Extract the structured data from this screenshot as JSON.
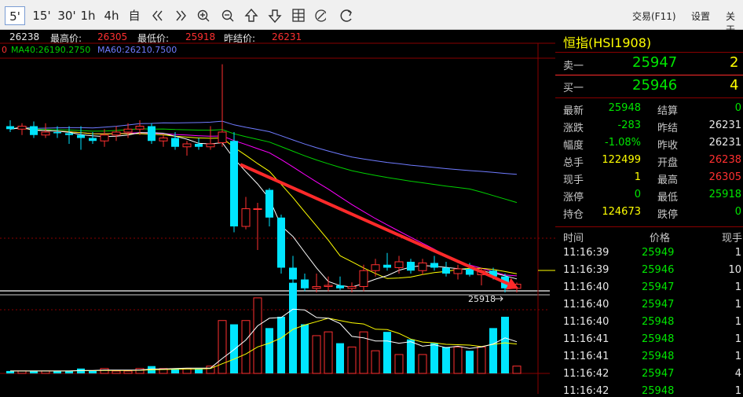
{
  "toolbar": {
    "periods": [
      "5'",
      "15'",
      "30'",
      "1h",
      "4h",
      "自"
    ],
    "right_items": [
      "交易(F11)",
      "设置",
      "关于"
    ],
    "icons": [
      "double-left-icon",
      "double-right-icon",
      "zoom-in-icon",
      "zoom-out-icon",
      "up-arrow-icon",
      "down-arrow-icon",
      "layout-icon",
      "draw-icon",
      "refresh-icon"
    ]
  },
  "chart_header": {
    "open_value": "26238",
    "high_label": "最高价:",
    "high_value": "26305",
    "low_label": "最低价:",
    "low_value": "25918",
    "prev_label": "昨结价:",
    "prev_value": "26231"
  },
  "ma_line": {
    "prefix": "0",
    "ma40": "MA40:26190.2750",
    "ma60": "MA60:26210.7500"
  },
  "low_marker": "25918",
  "colors": {
    "up": "#ff3030",
    "down": "#00e5ff",
    "arrow": "#ff2a2a",
    "ma5": "#ffffff",
    "ma10": "#ffff00",
    "ma20": "#ff00ff",
    "ma40": "#00d000",
    "ma60": "#6f7bff",
    "divider": "#8a0000"
  },
  "chart_data": {
    "type": "candlestick",
    "title": "",
    "candles": [
      {
        "o": 26200,
        "h": 26210,
        "l": 26190,
        "c": 26195,
        "v": 1
      },
      {
        "o": 26195,
        "h": 26205,
        "l": 26185,
        "c": 26200,
        "v": 1
      },
      {
        "o": 26200,
        "h": 26208,
        "l": 26180,
        "c": 26185,
        "v": 1
      },
      {
        "o": 26185,
        "h": 26205,
        "l": 26180,
        "c": 26190,
        "v": 1
      },
      {
        "o": 26190,
        "h": 26200,
        "l": 26180,
        "c": 26188,
        "v": 1
      },
      {
        "o": 26188,
        "h": 26200,
        "l": 26170,
        "c": 26185,
        "v": 1
      },
      {
        "o": 26185,
        "h": 26200,
        "l": 26160,
        "c": 26180,
        "v": 2
      },
      {
        "o": 26180,
        "h": 26190,
        "l": 26170,
        "c": 26175,
        "v": 1
      },
      {
        "o": 26175,
        "h": 26195,
        "l": 26165,
        "c": 26185,
        "v": 2
      },
      {
        "o": 26185,
        "h": 26200,
        "l": 26175,
        "c": 26190,
        "v": 1
      },
      {
        "o": 26190,
        "h": 26205,
        "l": 26180,
        "c": 26195,
        "v": 1
      },
      {
        "o": 26195,
        "h": 26210,
        "l": 26185,
        "c": 26200,
        "v": 2
      },
      {
        "o": 26200,
        "h": 26205,
        "l": 26170,
        "c": 26175,
        "v": 3
      },
      {
        "o": 26175,
        "h": 26185,
        "l": 26165,
        "c": 26180,
        "v": 2
      },
      {
        "o": 26180,
        "h": 26190,
        "l": 26160,
        "c": 26165,
        "v": 2
      },
      {
        "o": 26165,
        "h": 26175,
        "l": 26150,
        "c": 26170,
        "v": 2
      },
      {
        "o": 26170,
        "h": 26180,
        "l": 26160,
        "c": 26165,
        "v": 2
      },
      {
        "o": 26165,
        "h": 26200,
        "l": 26160,
        "c": 26170,
        "v": 3
      },
      {
        "o": 26172,
        "h": 26305,
        "l": 26165,
        "c": 26190,
        "v": 14
      },
      {
        "o": 26175,
        "h": 26190,
        "l": 26020,
        "c": 26030,
        "v": 13
      },
      {
        "o": 26030,
        "h": 26080,
        "l": 26025,
        "c": 26060,
        "v": 14
      },
      {
        "o": 26060,
        "h": 26070,
        "l": 25990,
        "c": 26060,
        "v": 20
      },
      {
        "o": 26092,
        "h": 26095,
        "l": 26030,
        "c": 26045,
        "v": 12
      },
      {
        "o": 26045,
        "h": 26050,
        "l": 25950,
        "c": 25960,
        "v": 15
      },
      {
        "o": 25960,
        "h": 25980,
        "l": 25930,
        "c": 25940,
        "v": 24
      },
      {
        "o": 25940,
        "h": 25950,
        "l": 25920,
        "c": 25925,
        "v": 13
      },
      {
        "o": 25925,
        "h": 25950,
        "l": 25918,
        "c": 25928,
        "v": 10
      },
      {
        "o": 25928,
        "h": 25945,
        "l": 25920,
        "c": 25930,
        "v": 11
      },
      {
        "o": 25930,
        "h": 25945,
        "l": 25922,
        "c": 25925,
        "v": 8
      },
      {
        "o": 25925,
        "h": 25935,
        "l": 25918,
        "c": 25928,
        "v": 7
      },
      {
        "o": 25928,
        "h": 25965,
        "l": 25920,
        "c": 25955,
        "v": 11
      },
      {
        "o": 25955,
        "h": 25975,
        "l": 25945,
        "c": 25965,
        "v": 6
      },
      {
        "o": 25965,
        "h": 25985,
        "l": 25955,
        "c": 25960,
        "v": 11
      },
      {
        "o": 25960,
        "h": 25980,
        "l": 25950,
        "c": 25970,
        "v": 5
      },
      {
        "o": 25970,
        "h": 25975,
        "l": 25950,
        "c": 25955,
        "v": 9
      },
      {
        "o": 25955,
        "h": 25975,
        "l": 25948,
        "c": 25968,
        "v": 5
      },
      {
        "o": 25968,
        "h": 25980,
        "l": 25955,
        "c": 25960,
        "v": 8
      },
      {
        "o": 25960,
        "h": 25970,
        "l": 25945,
        "c": 25950,
        "v": 7
      },
      {
        "o": 25950,
        "h": 25965,
        "l": 25940,
        "c": 25958,
        "v": 7
      },
      {
        "o": 25958,
        "h": 25968,
        "l": 25945,
        "c": 25948,
        "v": 6
      },
      {
        "o": 25948,
        "h": 25960,
        "l": 25930,
        "c": 25955,
        "v": 7
      },
      {
        "o": 25955,
        "h": 25960,
        "l": 25940,
        "c": 25945,
        "v": 12
      },
      {
        "o": 25945,
        "h": 25950,
        "l": 25918,
        "c": 25925,
        "v": 15
      },
      {
        "o": 25925,
        "h": 25935,
        "l": 25918,
        "c": 25932,
        "v": 3
      }
    ],
    "ma_series": [
      {
        "name": "MA40",
        "last": "26190.2750"
      },
      {
        "name": "MA60",
        "last": "26210.7500"
      }
    ],
    "annotation": {
      "type": "arrow",
      "from_candle": 19,
      "from_price": 26135,
      "to_candle": 43,
      "to_price": 25925
    },
    "low_price": 25918
  },
  "side": {
    "title": "恒指(HSI1908)",
    "sell": {
      "label": "卖一",
      "price": "25947",
      "qty": "2"
    },
    "buy": {
      "label": "买一",
      "price": "25946",
      "qty": "4"
    },
    "stats": [
      {
        "l1": "最新",
        "v1": "25948",
        "c1": "grn",
        "l2": "结算",
        "v2": "0",
        "c2": "grn"
      },
      {
        "l1": "涨跌",
        "v1": "-283",
        "c1": "grn",
        "l2": "昨结",
        "v2": "26231",
        "c2": "wht"
      },
      {
        "l1": "幅度",
        "v1": "-1.08%",
        "c1": "grn",
        "l2": "昨收",
        "v2": "26231",
        "c2": "wht"
      },
      {
        "l1": "总手",
        "v1": "122499",
        "c1": "yel",
        "l2": "开盘",
        "v2": "26238",
        "c2": "red"
      },
      {
        "l1": "现手",
        "v1": "1",
        "c1": "yel",
        "l2": "最高",
        "v2": "26305",
        "c2": "red"
      },
      {
        "l1": "涨停",
        "v1": "0",
        "c1": "grn",
        "l2": "最低",
        "v2": "25918",
        "c2": "grn"
      },
      {
        "l1": "持仓",
        "v1": "124673",
        "c1": "yel",
        "l2": "跌停",
        "v2": "0",
        "c2": "grn"
      }
    ],
    "ticks_header": {
      "time": "时间",
      "price": "价格",
      "qty": "现手"
    },
    "ticks": [
      {
        "time": "11:16:39",
        "price": "25949",
        "qty": "1"
      },
      {
        "time": "11:16:39",
        "price": "25946",
        "qty": "10"
      },
      {
        "time": "11:16:40",
        "price": "25947",
        "qty": "1"
      },
      {
        "time": "11:16:40",
        "price": "25947",
        "qty": "1"
      },
      {
        "time": "11:16:40",
        "price": "25948",
        "qty": "1"
      },
      {
        "time": "11:16:41",
        "price": "25948",
        "qty": "1"
      },
      {
        "time": "11:16:41",
        "price": "25948",
        "qty": "1"
      },
      {
        "time": "11:16:42",
        "price": "25947",
        "qty": "4"
      },
      {
        "time": "11:16:42",
        "price": "25948",
        "qty": "1"
      }
    ]
  }
}
